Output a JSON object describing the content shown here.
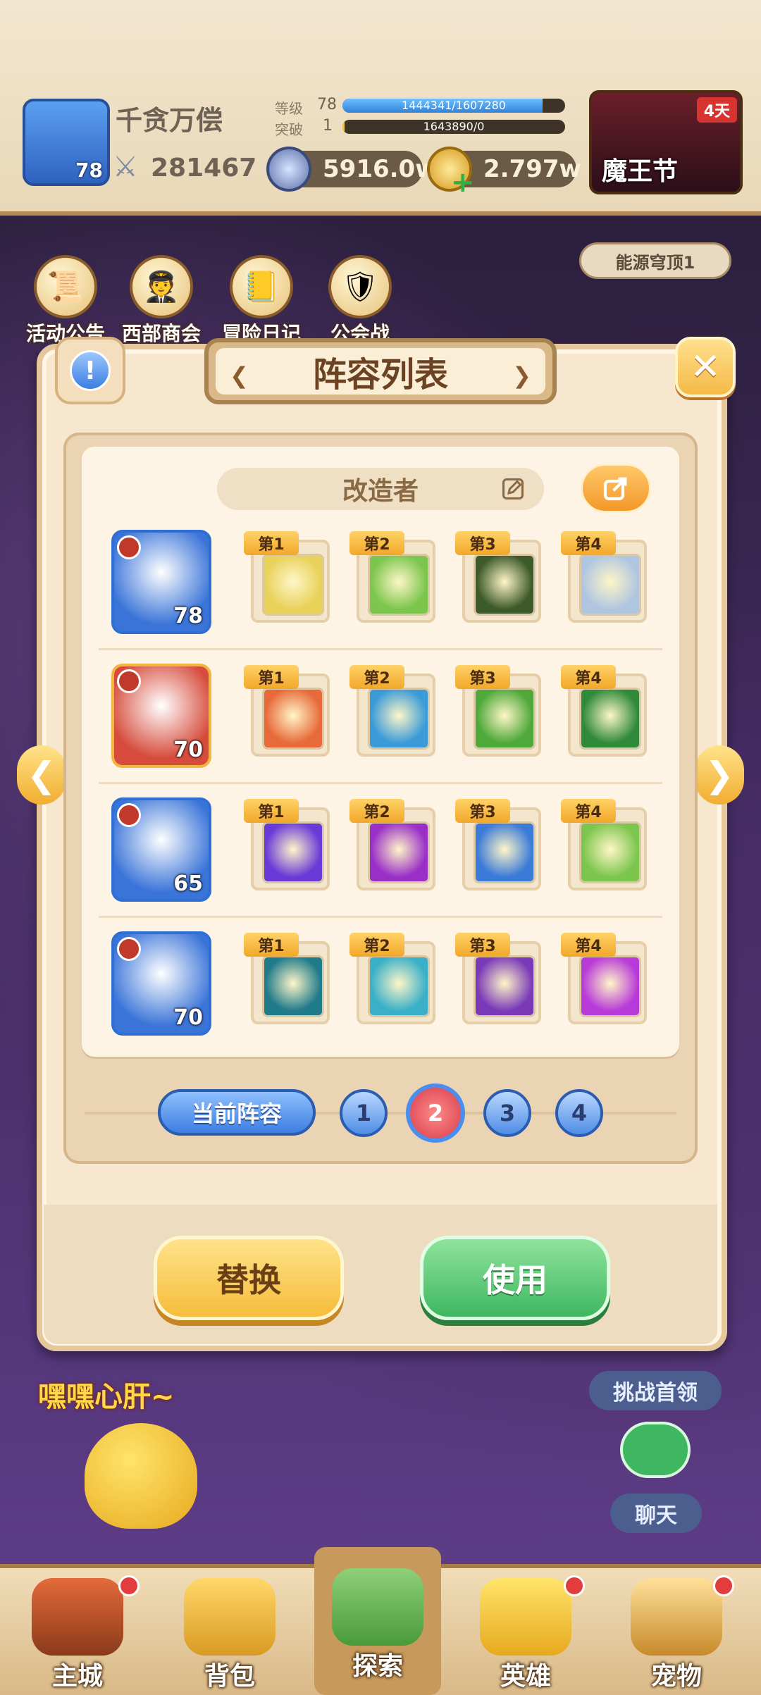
{
  "header": {
    "player_name": "千贪万偿",
    "avatar_level": "78",
    "power": "281467",
    "level_label": "等级",
    "level_value": "78",
    "level_exp": "1444341/1607280",
    "level_progress": 0.9,
    "breakthrough_label": "突破",
    "breakthrough_value": "1",
    "breakthrough_exp": "1643890/0",
    "breakthrough_progress": 0.0,
    "silver": "5916.0w",
    "gold": "2.797w",
    "event_label": "魔王节",
    "event_badge": "4天"
  },
  "menu": {
    "items": [
      "活动公告",
      "西部商会",
      "冒险日记",
      "公会战"
    ],
    "energy_dome": "能源穹顶1"
  },
  "dialog": {
    "title": "阵容列表",
    "lineup_name": "改造者",
    "slot_labels": [
      "第1",
      "第2",
      "第3",
      "第4"
    ],
    "heroes": [
      {
        "level": "78",
        "color": "#3a74d8",
        "skills": [
          "#e8d25a",
          "#7cc64d",
          "#3d5a2a",
          "#b0c6e0"
        ]
      },
      {
        "level": "70",
        "color": "#d64b3b",
        "skills": [
          "#e86a3a",
          "#3a9bd8",
          "#4ea83a",
          "#2f8a3a"
        ]
      },
      {
        "level": "65",
        "color": "#3a74d8",
        "skills": [
          "#6a3ad8",
          "#9a2fc8",
          "#3a7ad8",
          "#7cc64d"
        ]
      },
      {
        "level": "70",
        "color": "#3a74d8",
        "skills": [
          "#1f7a8a",
          "#3ab0c8",
          "#7a3ab8",
          "#b83ad8"
        ]
      }
    ],
    "current_lineup_label": "当前阵容",
    "tabs": [
      "1",
      "2",
      "3",
      "4"
    ],
    "active_tab": "2",
    "replace_label": "替换",
    "use_label": "使用"
  },
  "background": {
    "mascot_text": "嘿嘿心肝~",
    "challenge_label": "挑战首领",
    "chat_label": "聊天"
  },
  "bottom_nav": {
    "items": [
      "主城",
      "背包",
      "探索",
      "英雄",
      "宠物"
    ]
  }
}
